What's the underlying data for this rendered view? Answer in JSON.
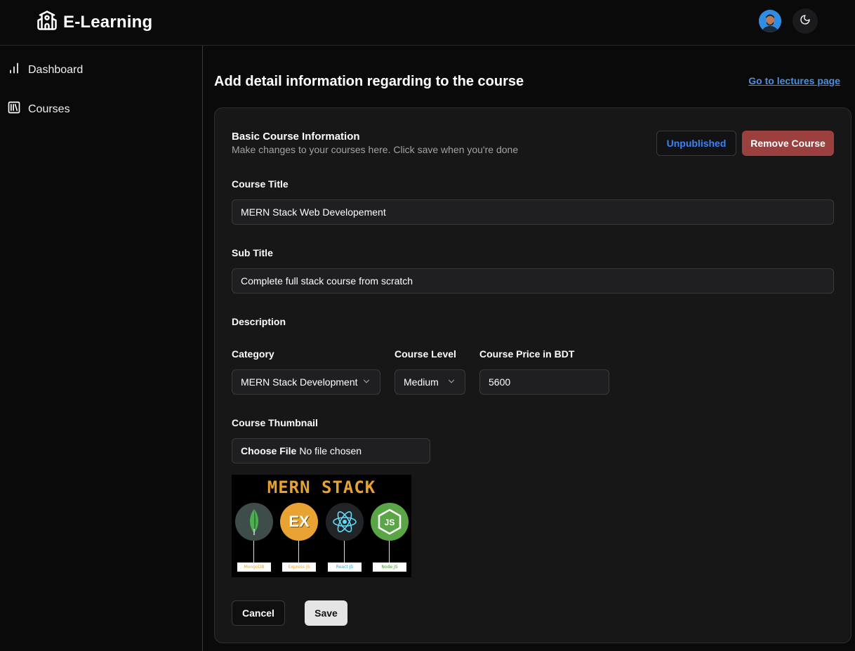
{
  "header": {
    "brand_title": "E-Learning",
    "brand_icon": "school-icon",
    "avatar_icon": "avatar",
    "theme_icon": "moon-icon"
  },
  "sidebar": {
    "items": [
      {
        "label": "Dashboard",
        "icon": "bar-chart-icon"
      },
      {
        "label": "Courses",
        "icon": "library-icon"
      }
    ]
  },
  "main": {
    "title": "Add detail information regarding to the course",
    "lectures_link": "Go to lectures page",
    "card": {
      "title": "Basic Course Information",
      "description": "Make changes to your courses here. Click save when you're done",
      "unpublished_label": "Unpublished",
      "remove_label": "Remove Course",
      "course_title_label": "Course Title",
      "course_title_value": "MERN Stack Web Developement",
      "subtitle_label": "Sub Title",
      "subtitle_value": "Complete full stack course from scratch",
      "description_label": "Description",
      "category_label": "Category",
      "category_value": "MERN Stack Development",
      "level_label": "Course Level",
      "level_value": "Medium",
      "price_label": "Course Price in BDT",
      "price_value": "5600",
      "thumbnail_label": "Course Thumbnail",
      "file_button": "Choose File",
      "file_status": "No file chosen",
      "thumbnail": {
        "title": "MERN STACK",
        "techs": [
          {
            "letter": "",
            "label": "MongoDB",
            "bg": "#3f4d4a",
            "label_color": "#e8a232"
          },
          {
            "letter": "EX",
            "label": "Express JS",
            "bg": "#e9a333",
            "label_color": "#e8a232"
          },
          {
            "letter": "",
            "label": "React JS",
            "bg": "#222527",
            "label_color": "#2fa7d9"
          },
          {
            "letter": "JS",
            "label": "Node JS",
            "bg": "#5aa545",
            "label_color": "#4a8f3a"
          }
        ]
      },
      "cancel_label": "Cancel",
      "save_label": "Save"
    }
  },
  "colors": {
    "accent_link": "#4a90e2",
    "unpublished_text": "#3b82f6",
    "remove_bg": "#9b3f3f",
    "background": "#0a0a0a",
    "card_bg": "#171717"
  }
}
